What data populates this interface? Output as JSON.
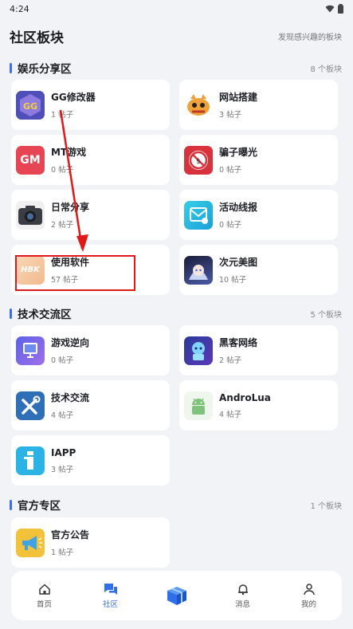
{
  "status": {
    "time": "4:24"
  },
  "header": {
    "title": "社区板块",
    "link": "发现感兴趣的板块"
  },
  "sections": [
    {
      "title": "娱乐分享区",
      "count": "8 个板块",
      "cards": [
        {
          "name": "GG修改器",
          "count": "1 帖子",
          "icon": "gg-icon"
        },
        {
          "name": "网站搭建",
          "count": "3 帖子",
          "icon": "website-icon"
        },
        {
          "name": "MT游戏",
          "count": "0 帖子",
          "icon": "gm-icon",
          "icon_text": "GM"
        },
        {
          "name": "骗子曝光",
          "count": "0 帖子",
          "icon": "scam-icon"
        },
        {
          "name": "日常分享",
          "count": "2 帖子",
          "icon": "camera-icon"
        },
        {
          "name": "活动线报",
          "count": "0 帖子",
          "icon": "activity-icon"
        },
        {
          "name": "使用软件",
          "count": "57 帖子",
          "icon": "software-icon",
          "icon_text": "HBK"
        },
        {
          "name": "次元美图",
          "count": "10 帖子",
          "icon": "anime-icon"
        }
      ]
    },
    {
      "title": "技术交流区",
      "count": "5 个板块",
      "cards": [
        {
          "name": "游戏逆向",
          "count": "0 帖子",
          "icon": "reverse-icon"
        },
        {
          "name": "黑客网络",
          "count": "2 帖子",
          "icon": "hacker-icon"
        },
        {
          "name": "技术交流",
          "count": "4 帖子",
          "icon": "tools-icon"
        },
        {
          "name": "AndroLua",
          "count": "4 帖子",
          "icon": "android-icon"
        },
        {
          "name": "IAPP",
          "count": "3 帖子",
          "icon": "iapp-icon"
        }
      ]
    },
    {
      "title": "官方专区",
      "count": "1 个板块",
      "cards": [
        {
          "name": "官方公告",
          "count": "1 帖子",
          "icon": "megaphone-icon"
        }
      ]
    }
  ],
  "nav": {
    "items": [
      {
        "label": "首页",
        "icon": "home-icon"
      },
      {
        "label": "社区",
        "icon": "chat-icon",
        "active": true
      },
      {
        "label": "",
        "icon": "gift-icon"
      },
      {
        "label": "消息",
        "icon": "bell-icon"
      },
      {
        "label": "我的",
        "icon": "user-icon"
      }
    ]
  },
  "colors": {
    "accent": "#2f6fe8",
    "section_bar": "#3f6fe0",
    "annotation": "#e01818"
  }
}
